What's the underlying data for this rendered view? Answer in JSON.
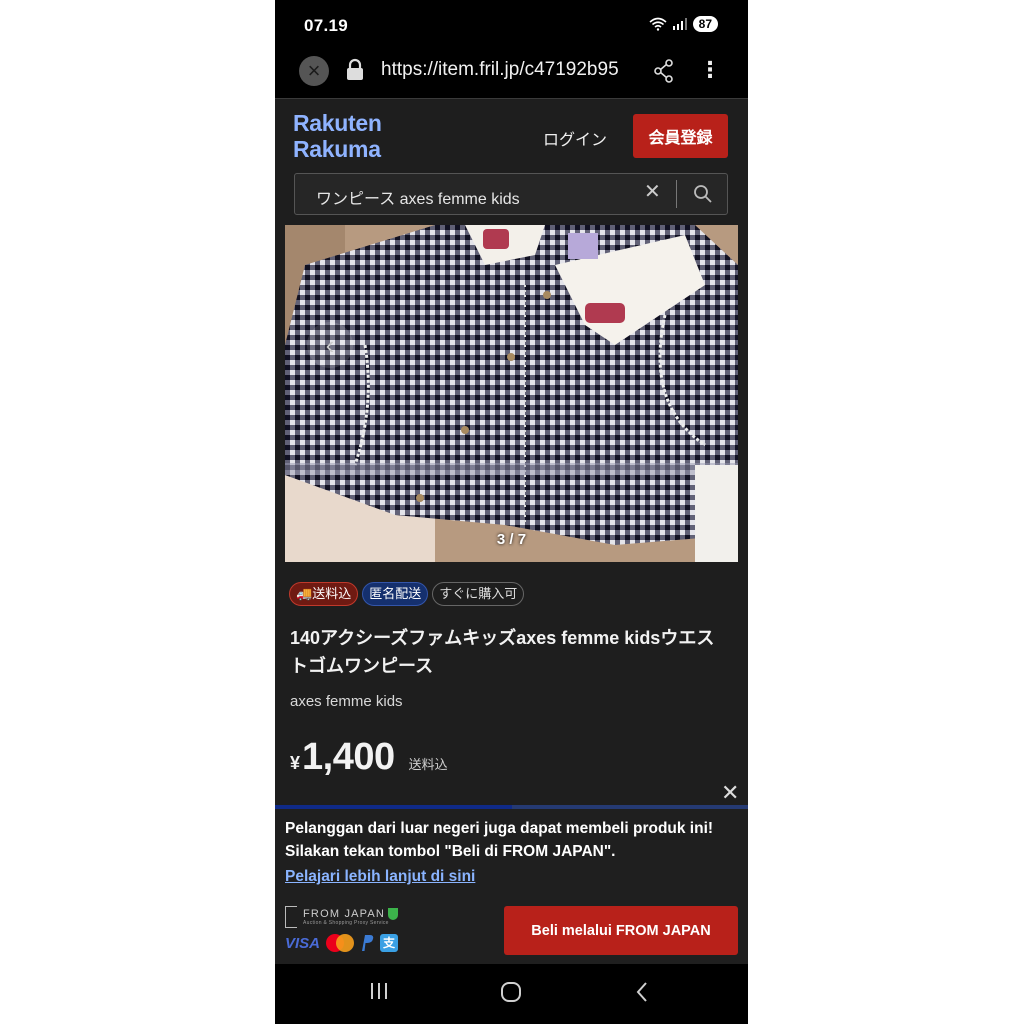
{
  "status_bar": {
    "time": "07.19",
    "battery": "87"
  },
  "browser": {
    "url": "https://item.fril.jp/c47192b95"
  },
  "header": {
    "logo_line1": "Rakuten",
    "logo_line2": "Rakuma",
    "login_label": "ログイン",
    "register_label": "会員登録"
  },
  "search": {
    "query": "ワンピース axes femme kids"
  },
  "gallery": {
    "counter": "3 / 7",
    "current": 3,
    "total": 7
  },
  "badges": [
    {
      "label": "送料込",
      "icon": "truck-icon"
    },
    {
      "label": "匿名配送"
    },
    {
      "label": "すぐに購入可"
    }
  ],
  "product": {
    "title": "140アクシーズファムキッズaxes femme kidsウエストゴムワンピース",
    "brand": "axes femme kids",
    "currency": "¥",
    "price": "1,400",
    "shipping": "送料込"
  },
  "banner": {
    "progress": 0.5,
    "message": "Pelanggan dari luar negeri juga dapat membeli produk ini! Silakan tekan tombol \"Beli di FROM JAPAN\".",
    "link": "Pelajari lebih lanjut di sini",
    "fj_name": "FROM JAPAN",
    "fj_tagline": "Auction & Shopping Proxy Service",
    "visa": "VISA",
    "alipay": "支",
    "buy_label": "Beli melalui FROM JAPAN"
  },
  "colors": {
    "brand_red": "#b8211a",
    "logo_blue": "#8fb3ff",
    "link_blue": "#8ab4ff",
    "background": "#1e1e1e"
  }
}
